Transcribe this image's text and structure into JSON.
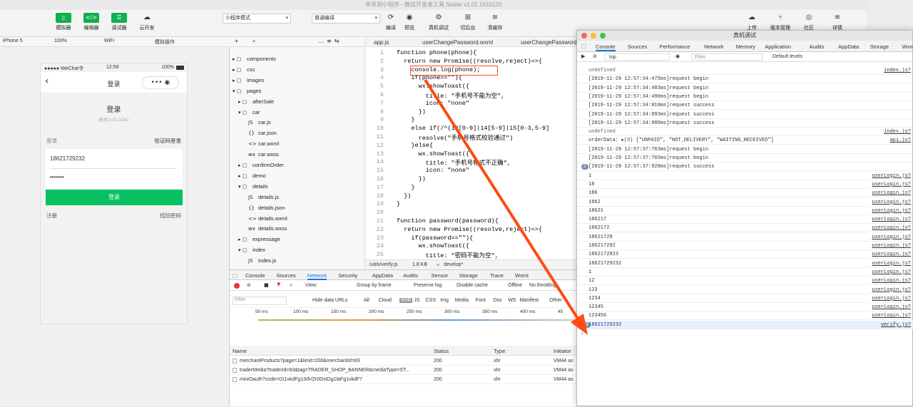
{
  "window_title": "爷爷测小程序 - 微信开发者工具 Stable v1.02.1910120",
  "toolbar": {
    "simulator": "模拟器",
    "editor": "编辑器",
    "debugger": "调试器",
    "cloud": "云开发",
    "mode": "小程序模式",
    "compile_mode": "普通编译",
    "compile": "编译",
    "preview": "预览",
    "remote_debug": "真机调试",
    "backstage": "切后台",
    "clear_cache": "清缓存",
    "upload": "上传",
    "version": "版本管理",
    "community": "社区",
    "details": "详情"
  },
  "device": {
    "model": "iPhone 5",
    "zoom": "100%",
    "network": "WiFi",
    "op": "模拟操作"
  },
  "phone": {
    "carrier": "●●●●● WeChat令",
    "time": "12:59",
    "battery": "100%",
    "nav_title": "登录",
    "heading": "登录",
    "sub": "推导入ID:3242",
    "label_login": "登录",
    "sms_login": "验证码登录",
    "phone_value": "18621729232",
    "password_value": "•••••••",
    "login_btn": "登录",
    "register": "注册",
    "forgot": "找回密码"
  },
  "filetree": {
    "items": [
      "components",
      "css",
      "images",
      "pages",
      "afterSale",
      "car",
      "car.js",
      "car.json",
      "car.wxml",
      "car.wxss",
      "confirmOrder",
      "demo",
      "details",
      "details.js",
      "details.json",
      "details.wxml",
      "details.wxss",
      "expressage",
      "index",
      "index.js"
    ]
  },
  "editor": {
    "tabs": [
      "app.js",
      "userChangePassword.wxml",
      "userChangePassword.js"
    ],
    "line_numbers": [
      "1",
      "2",
      "3",
      "4",
      "5",
      "6",
      "7",
      "8",
      "9",
      "10",
      "11",
      "12",
      "13",
      "14",
      "15",
      "16",
      "17",
      "18",
      "19",
      "20",
      "21",
      "22",
      "23",
      "24",
      "25"
    ],
    "lines": [
      "function phone(phone){",
      "  return new Promise((resolve,reject)=>{",
      "    console.log(phone);",
      "    if(phone==\"\"){",
      "      wx.showToast({",
      "        title: \"手机号不能为空\",",
      "        icon: \"none\"",
      "      })",
      "    }",
      "    else if(/^(13[0-9]|14[5-9]|15[0-3,5-9]",
      "      resolve(\"手机号格式校验通过\")",
      "    }else{",
      "      wx.showToast({",
      "        title: \"手机号格式不正确\",",
      "        icon: \"none\"",
      "      })",
      "    }",
      "  })",
      "}",
      "",
      "function password(password){",
      "  return new Promise((resolve,reject)=>{",
      "    if(password==\"\"){",
      "      wx.showToast({",
      "        title: \"密码不能为空\","
    ],
    "status_path": "/utils/verify.js",
    "status_size": "1.8 KB",
    "status_branch": "develop*"
  },
  "devtools": {
    "tabs": [
      "Console",
      "Sources",
      "Network",
      "Security",
      "AppData",
      "Audits",
      "Sensor",
      "Storage",
      "Trace",
      "Wxml"
    ],
    "view": "View:",
    "group_by_frame": "Group by frame",
    "preserve_log": "Preserve log",
    "disable_cache": "Disable cache",
    "offline": "Offline",
    "throttling": "No throttling",
    "filter": "Filter",
    "hide_urls": "Hide data URLs",
    "types": [
      "All",
      "Cloud",
      "XHR",
      "JS",
      "CSS",
      "Img",
      "Media",
      "Font",
      "Doc",
      "WS",
      "Manifest",
      "Other"
    ],
    "ticks": [
      "50 ms",
      "100 ms",
      "150 ms",
      "200 ms",
      "250 ms",
      "300 ms",
      "350 ms",
      "400 ms",
      "45"
    ],
    "columns": [
      "Name",
      "Status",
      "Type",
      "Initiator"
    ],
    "rows": [
      {
        "name": "merchantProducts?page=1&limit=200&merchantId=83",
        "status": "200",
        "type": "xhr",
        "init": "VM44 as"
      },
      {
        "name": "traderMedia?traderId=83&tag=TRADER_SHOP_BANNER&mediaType=ST...",
        "status": "200",
        "type": "xhr",
        "init": "VM44 as"
      },
      {
        "name": "miniOauth?code=011vkdFg13dVZr0DsIDg1laFg1vkdF7",
        "status": "200",
        "type": "xhr",
        "init": "VM44 as"
      }
    ]
  },
  "console": {
    "title": "真机调试",
    "tabs": [
      "Console",
      "Sources",
      "Performance",
      "Network",
      "Memory",
      "Application",
      "Audits",
      "AppData",
      "Storage",
      "Wxml"
    ],
    "context": "top",
    "filter": "Filter",
    "levels": "Default levels",
    "rows": [
      {
        "count": "",
        "msg": "undefined",
        "src": "index.js?",
        "gray": true
      },
      {
        "count": "",
        "msg": "[2019-11-29 12:57:34:475ms]request begin",
        "src": ""
      },
      {
        "count": "",
        "msg": "[2019-11-29 12:57:34:483ms]request begin",
        "src": ""
      },
      {
        "count": "",
        "msg": "[2019-11-29 12:57:34:490ms]request begin",
        "src": ""
      },
      {
        "count": "",
        "msg": "[2019-11-29 12:57:34:810ms]request success",
        "src": ""
      },
      {
        "count": "",
        "msg": "[2019-11-29 12:57:34:893ms]request success",
        "src": ""
      },
      {
        "count": "",
        "msg": "[2019-11-29 12:57:34:980ms]request success",
        "src": ""
      },
      {
        "count": "",
        "msg": "undefined",
        "src": "index.js?",
        "gray": true
      },
      {
        "count": "",
        "msg": "orderData: ▸(3) [\"UNPAID\", \"NOT_DELIVERY\", \"WAITING_RECEIVED\"]",
        "src": "api.js?"
      },
      {
        "count": "",
        "msg": "[2019-11-29 12:57:37:763ms]request begin",
        "src": ""
      },
      {
        "count": "",
        "msg": "[2019-11-29 12:57:37:765ms]request begin",
        "src": ""
      },
      {
        "count": "2",
        "msg": "[2019-11-29 12:57:37:920ms]request success",
        "src": ""
      },
      {
        "count": "",
        "msg": "1",
        "src": "userLogin.js?"
      },
      {
        "count": "",
        "msg": "18",
        "src": "userLogin.js?"
      },
      {
        "count": "",
        "msg": "186",
        "src": "userLogin.js?"
      },
      {
        "count": "",
        "msg": "1862",
        "src": "userLogin.js?"
      },
      {
        "count": "",
        "msg": "18621",
        "src": "userLogin.js?"
      },
      {
        "count": "",
        "msg": "186217",
        "src": "userLogin.js?"
      },
      {
        "count": "",
        "msg": "1862172",
        "src": "userLogin.js?"
      },
      {
        "count": "",
        "msg": "18621729",
        "src": "userLogin.js?"
      },
      {
        "count": "",
        "msg": "186217292",
        "src": "userLogin.js?"
      },
      {
        "count": "",
        "msg": "1862172923",
        "src": "userLogin.js?"
      },
      {
        "count": "",
        "msg": "18621729232",
        "src": "userLogin.js?"
      },
      {
        "count": "",
        "msg": "1",
        "src": "userLogin.js?"
      },
      {
        "count": "",
        "msg": "12",
        "src": "userLogin.js?"
      },
      {
        "count": "",
        "msg": "123",
        "src": "userLogin.js?"
      },
      {
        "count": "",
        "msg": "1234",
        "src": "userLogin.js?"
      },
      {
        "count": "",
        "msg": "12345",
        "src": "userLogin.js?"
      },
      {
        "count": "",
        "msg": "123456",
        "src": "userLogin.js?"
      },
      {
        "count": "29",
        "msg": "18621729232",
        "src": "verify.js?",
        "highlight": true
      }
    ],
    "prompt": "›"
  },
  "colors": {
    "accent_green": "#07c160",
    "annotation": "#ff4a12"
  }
}
